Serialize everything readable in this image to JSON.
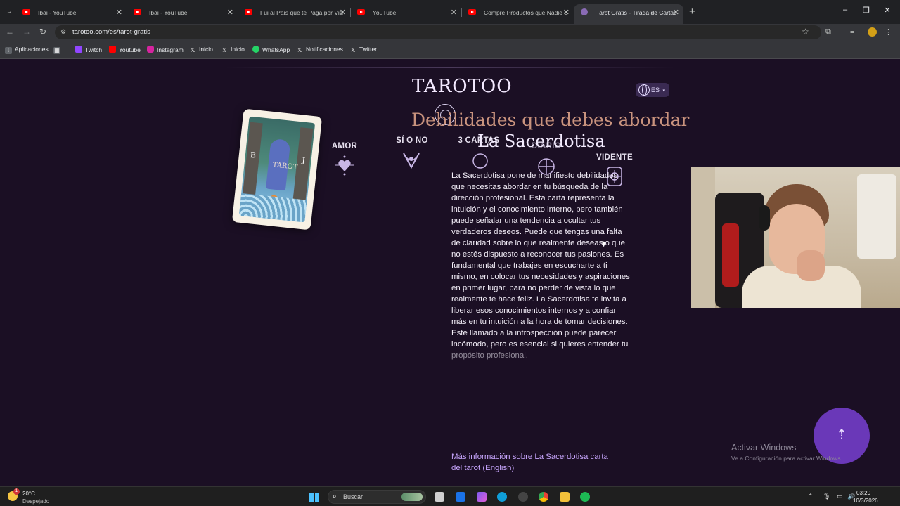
{
  "browser": {
    "tabs": [
      {
        "title": "Ibai - YouTube",
        "favicon": "youtube-icon"
      },
      {
        "title": "Ibai - YouTube",
        "favicon": "youtube-icon"
      },
      {
        "title": "Fui al País que te Paga por Visit",
        "favicon": "youtube-icon"
      },
      {
        "title": "YouTube",
        "favicon": "youtube-icon"
      },
      {
        "title": "Compré Productos que Nadie C",
        "favicon": "youtube-icon"
      },
      {
        "title": "Tarot Gratis - Tirada de Cartas d",
        "favicon": "tarotoo-icon",
        "active": true
      }
    ],
    "tab_close": "✕",
    "new_tab": "+",
    "url": "tarotoo.com/es/tarot-gratis",
    "bookmarks": [
      {
        "label": "Aplicaciones",
        "icon": "apps-grid-icon"
      },
      {
        "label": "Twitch",
        "icon": "twitch-icon"
      },
      {
        "label": "Youtube",
        "icon": "youtube-icon"
      },
      {
        "label": "Instagram",
        "icon": "instagram-icon"
      },
      {
        "label": "Inicio",
        "icon": "x-icon"
      },
      {
        "label": "Inicio",
        "icon": "x-icon"
      },
      {
        "label": "WhatsApp",
        "icon": "whatsapp-icon"
      },
      {
        "label": "Notificaciones",
        "icon": "x-icon"
      },
      {
        "label": "Twitter",
        "icon": "x-icon"
      }
    ]
  },
  "site": {
    "logo": "TAROTOO",
    "language": "ES",
    "card_word": "TAROT",
    "card_letters": {
      "left": "B",
      "right": "J"
    },
    "categories": [
      {
        "label": "AMOR",
        "icon": "heart-icon"
      },
      {
        "label": "SÍ O NO",
        "icon": "yes-no-icon"
      },
      {
        "label": "3 CARTAS",
        "icon": "three-cards-icon"
      },
      {
        "label": "DIARIO",
        "icon": "daily-icon"
      },
      {
        "label": "VIDENTE",
        "icon": "seer-icon"
      }
    ],
    "headline": "Debilidades que debes abordar",
    "card_name": "La Sacerdotisa",
    "description_main": "La Sacerdotisa pone de manifiesto debilidades que necesitas abordar en tu búsqueda de la dirección profesional. Esta carta representa la intuición y el conocimiento interno, pero también puede señalar una tendencia a ocultar tus verdaderos deseos. Puede que tengas una falta de claridad sobre lo que realmente deseas o que no estés dispuesto a reconocer tus pasiones. Es fundamental que trabajes en escucharte a ti mismo, en colocar tus necesidades y aspiraciones en primer lugar, para no perder de vista lo que realmente te hace feliz. La Sacerdotisa te invita a liberar esos conocimientos internos y a confiar más en tu intuición a la hora de tomar decisiones. Este llamado a la introspección puede parecer incómodo, pero es esencial si quieres entender tu",
    "description_fade": "propósito profesional.",
    "more_link": "Más información sobre La Sacerdotisa carta del tarot (English)",
    "scroll_up": "⇡"
  },
  "windows": {
    "activate_title": "Activar Windows",
    "activate_sub": "Ve a Configuración para activar Windows.",
    "weather_temp": "20°C",
    "weather_desc": "Despejado",
    "weather_badge": "1",
    "search_placeholder": "Buscar",
    "time": "03:20",
    "date": "10/3/2026"
  },
  "colors": {
    "page_bg": "#1b0f24",
    "headline": "#c9937e",
    "link": "#c9a7ff",
    "accent_button": "#6a38b8"
  }
}
